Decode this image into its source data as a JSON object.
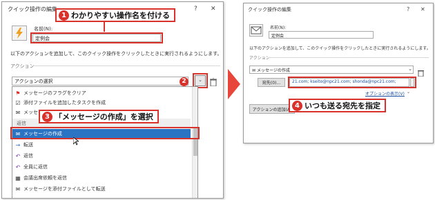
{
  "left": {
    "title": "クイック操作の編集",
    "help": "?",
    "close": "✕",
    "name_label": "名前(N):",
    "name_value": "定例会",
    "description": "以下のアクションを追加して、このクイック操作をクリックしたときに実行されるようにします。",
    "actions_label": "アクション",
    "select_value": "アクションの選択",
    "menu_items": [
      {
        "icon": "flag-icon",
        "glyph": "⚑",
        "label": "メッセージのフラグをクリア"
      },
      {
        "icon": "task-icon",
        "glyph": "☑",
        "label": "添付ファイルを追加したタスクを作成"
      },
      {
        "icon": "message-icon",
        "glyph": "✉",
        "label": "メッセージ"
      },
      {
        "icon": "",
        "glyph": "",
        "label": "返信"
      },
      {
        "icon": "envelope-icon",
        "glyph": "✉",
        "label": "メッセージの作成"
      },
      {
        "icon": "forward-icon",
        "glyph": "→",
        "label": "転送"
      },
      {
        "icon": "reply-icon",
        "glyph": "↶",
        "label": "返信"
      },
      {
        "icon": "reply-all-icon",
        "glyph": "↶",
        "label": "全員に返信"
      },
      {
        "icon": "meeting-icon",
        "glyph": "▦",
        "label": "会議出席依頼を返信"
      },
      {
        "icon": "attach-forward-icon",
        "glyph": "✉",
        "label": "メッセージを添付ファイルとして転送"
      }
    ]
  },
  "right": {
    "title": "クイック操作の編集",
    "help": "?",
    "close": "✕",
    "name_label": "名前(N):",
    "name_value": "定例会",
    "description": "以下のアクションを追加して、このクイック操作をクリックしたときに実行されるようにします。",
    "actions_label": "アクション",
    "action_value": "メッセージの作成",
    "to_button": "宛先(0)...",
    "to_value": "21.com; kseito@npc21.com; shonda@npc21.com;",
    "options_link": "オプションの表示(V)",
    "add_action_button": "アクションの追加(A)"
  },
  "callouts": {
    "c1_num": "1",
    "c1_text": "わかりやすい操作名を付ける",
    "c2_num": "2",
    "c3_num": "3",
    "c3_text": "「メッセージの作成」を選択",
    "c4_num": "4",
    "c4_text": "いつも送る宛先を指定"
  },
  "colors": {
    "accent_red": "#d9322b",
    "selection_blue": "#2b74c4",
    "arrow_red": "#e8463a"
  }
}
